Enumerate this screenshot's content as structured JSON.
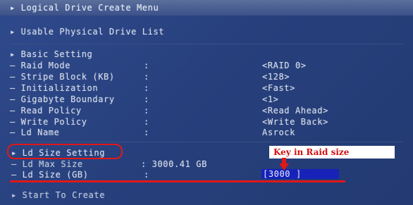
{
  "header": {
    "menu_title": "▸ Logical Drive Create Menu",
    "usable_drives": "▸ Usable Physical Drive List"
  },
  "basic_setting": {
    "heading": "▸ Basic Setting",
    "rows": [
      {
        "label": "– Raid Mode",
        "colon": ":",
        "value": "<RAID 0>"
      },
      {
        "label": "– Stripe Block (KB)",
        "colon": ":",
        "value": "<128>"
      },
      {
        "label": "– Initialization",
        "colon": ":",
        "value": "<Fast>"
      },
      {
        "label": "– Gigabyte Boundary",
        "colon": ":",
        "value": "<1>"
      },
      {
        "label": "– Read Policy",
        "colon": ":",
        "value": "<Read Ahead>"
      },
      {
        "label": "– Write Policy",
        "colon": ":",
        "value": "<Write Back>"
      },
      {
        "label": "– Ld Name",
        "colon": ":",
        "value": "Asrock"
      }
    ]
  },
  "ld_size_setting": {
    "heading": "▸ Ld Size Setting",
    "max_label": "– Ld Max Size",
    "max_value": ": 3000.41 GB",
    "size_label": "– Ld Size (GB)",
    "size_colon": ":",
    "size_input_value": "[3000      ]"
  },
  "annotation": {
    "callout_text": "Key in Raid size",
    "color": "#e01818"
  },
  "footer": {
    "start_to_create": "▸ Start To Create"
  }
}
